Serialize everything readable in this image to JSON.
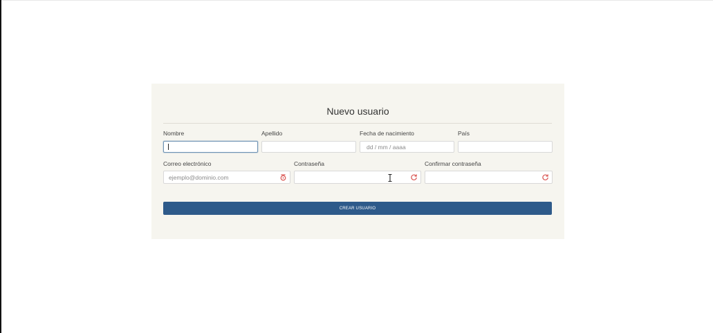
{
  "form": {
    "title": "Nuevo usuario",
    "fields": {
      "nombre": {
        "label": "Nombre",
        "value": ""
      },
      "apellido": {
        "label": "Apellido",
        "value": ""
      },
      "fecha_nacimiento": {
        "label": "Fecha de nacimiento",
        "placeholder": "dd / mm / aaaa"
      },
      "pais": {
        "label": "País",
        "value": ""
      },
      "correo": {
        "label": "Correo electrónico",
        "placeholder": "ejemplo@dominio.com",
        "icon": "password-manager-icon"
      },
      "contrasena": {
        "label": "Contraseña",
        "value": "",
        "icon": "password-manager-icon"
      },
      "confirmar_contrasena": {
        "label": "Confirmar contraseña",
        "value": "",
        "icon": "password-manager-icon"
      }
    },
    "submit_label": "CREAR USUARIO"
  },
  "colors": {
    "card_background": "#f6f5ef",
    "button_primary": "#2e5a8a",
    "focus_border": "#6f93b5",
    "icon_red": "#d9534f"
  }
}
